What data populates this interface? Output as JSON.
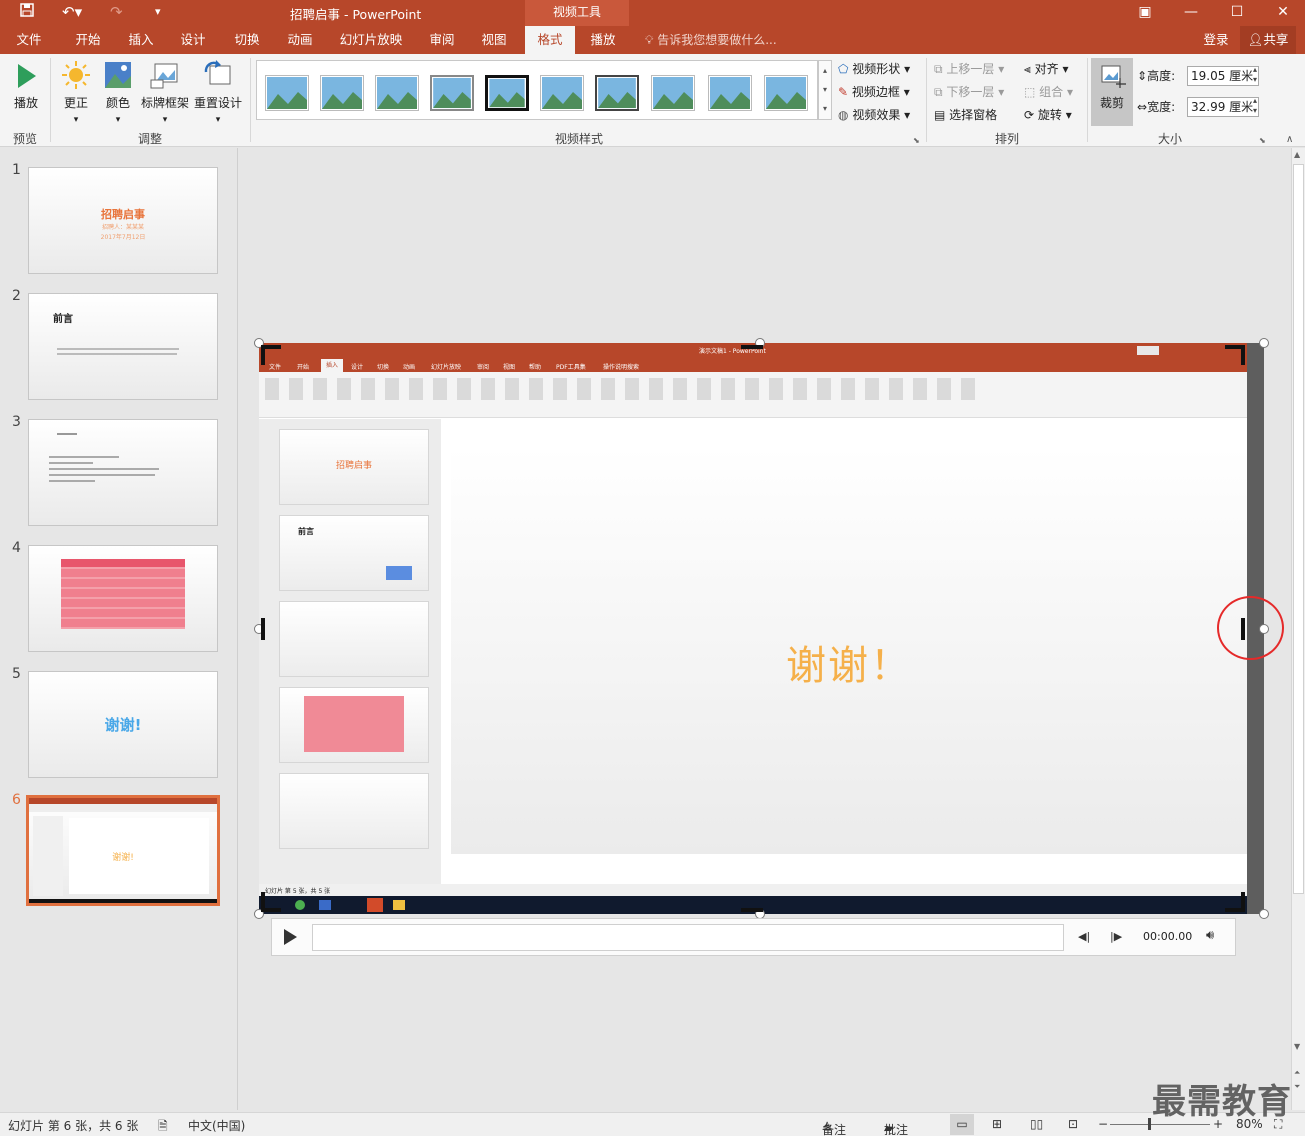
{
  "window": {
    "title": "招聘启事 - PowerPoint",
    "context_tab": "视频工具",
    "login": "登录",
    "share": "共享"
  },
  "tabs": [
    "文件",
    "开始",
    "插入",
    "设计",
    "切换",
    "动画",
    "幻灯片放映",
    "审阅",
    "视图",
    "格式",
    "播放"
  ],
  "active_tab": "格式",
  "tell_me": "告诉我您想要做什么...",
  "ribbon": {
    "preview": {
      "play": "播放",
      "group": "预览"
    },
    "adjust": {
      "correct": "更正",
      "color": "颜色",
      "poster": "标牌框架",
      "reset": "重置设计",
      "group": "调整"
    },
    "video_styles": {
      "group": "视频样式",
      "shape": "视频形状",
      "border": "视频边框",
      "effects": "视频效果"
    },
    "arrange": {
      "bring_forward": "上移一层",
      "send_backward": "下移一层",
      "selection_pane": "选择窗格",
      "align": "对齐",
      "group_btn": "组合",
      "rotate": "旋转",
      "group": "排列"
    },
    "size": {
      "crop": "裁剪",
      "height_label": "高度:",
      "height_value": "19.05 厘米",
      "width_label": "宽度:",
      "width_value": "32.99 厘米",
      "group": "大小"
    }
  },
  "slides": [
    {
      "num": "1",
      "title": "招聘启事",
      "sub1": "招聘人：某某某",
      "sub2": "2017年7月12日"
    },
    {
      "num": "2",
      "title": "前言"
    },
    {
      "num": "3",
      "title": ""
    },
    {
      "num": "4",
      "title": ""
    },
    {
      "num": "5",
      "title": "谢谢!"
    },
    {
      "num": "6",
      "title": "谢谢!"
    }
  ],
  "video_frame": {
    "inner_title": "演示文稿1 - PowerPoint",
    "inner_tabs": [
      "文件",
      "开始",
      "插入",
      "设计",
      "切换",
      "动画",
      "幻灯片放映",
      "审阅",
      "视图",
      "帮助",
      "PDF工具集",
      "操作说明搜索"
    ],
    "thanks_text": "谢谢！",
    "inner_slide1_title": "招聘启事",
    "inner_slide2_title": "前言",
    "inner_status": "幻灯片 第 5 张，共 5 张"
  },
  "player": {
    "time": "00:00.00"
  },
  "status": {
    "slide_info": "幻灯片 第 6 张，共 6 张",
    "language": "中文(中国)",
    "notes": "备注",
    "comments": "批注",
    "zoom": "80%"
  },
  "watermark": "最需教育",
  "colors": {
    "accent": "#b7472a",
    "selection": "#e0703f",
    "thanks_orange": "#f5b04a",
    "slide5_blue": "#4aa8e8",
    "annotation_red": "#e52a2a"
  }
}
